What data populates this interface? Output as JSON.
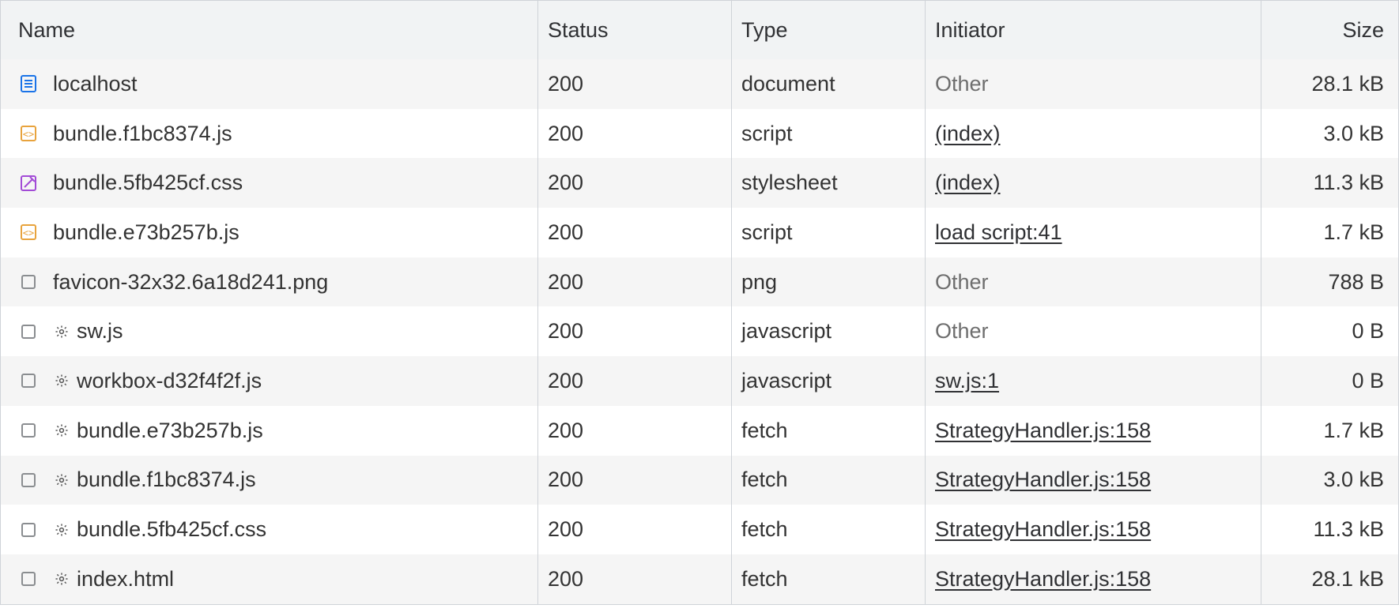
{
  "columns": {
    "name": "Name",
    "status": "Status",
    "type": "Type",
    "initiator": "Initiator",
    "size": "Size"
  },
  "rows": [
    {
      "icon": "document",
      "gear": false,
      "name": "localhost",
      "status": "200",
      "type": "document",
      "initiator": "Other",
      "initiator_link": false,
      "size": "28.1 kB"
    },
    {
      "icon": "js",
      "gear": false,
      "name": "bundle.f1bc8374.js",
      "status": "200",
      "type": "script",
      "initiator": "(index)",
      "initiator_link": true,
      "size": "3.0 kB"
    },
    {
      "icon": "css",
      "gear": false,
      "name": "bundle.5fb425cf.css",
      "status": "200",
      "type": "stylesheet",
      "initiator": "(index)",
      "initiator_link": true,
      "size": "11.3 kB"
    },
    {
      "icon": "js",
      "gear": false,
      "name": "bundle.e73b257b.js",
      "status": "200",
      "type": "script",
      "initiator": "load script:41",
      "initiator_link": true,
      "size": "1.7 kB"
    },
    {
      "icon": "blank",
      "gear": false,
      "name": "favicon-32x32.6a18d241.png",
      "status": "200",
      "type": "png",
      "initiator": "Other",
      "initiator_link": false,
      "size": "788 B"
    },
    {
      "icon": "blank",
      "gear": true,
      "name": "sw.js",
      "status": "200",
      "type": "javascript",
      "initiator": "Other",
      "initiator_link": false,
      "size": "0 B"
    },
    {
      "icon": "blank",
      "gear": true,
      "name": "workbox-d32f4f2f.js",
      "status": "200",
      "type": "javascript",
      "initiator": "sw.js:1",
      "initiator_link": true,
      "size": "0 B"
    },
    {
      "icon": "blank",
      "gear": true,
      "name": "bundle.e73b257b.js",
      "status": "200",
      "type": "fetch",
      "initiator": "StrategyHandler.js:158",
      "initiator_link": true,
      "size": "1.7 kB"
    },
    {
      "icon": "blank",
      "gear": true,
      "name": "bundle.f1bc8374.js",
      "status": "200",
      "type": "fetch",
      "initiator": "StrategyHandler.js:158",
      "initiator_link": true,
      "size": "3.0 kB"
    },
    {
      "icon": "blank",
      "gear": true,
      "name": "bundle.5fb425cf.css",
      "status": "200",
      "type": "fetch",
      "initiator": "StrategyHandler.js:158",
      "initiator_link": true,
      "size": "11.3 kB"
    },
    {
      "icon": "blank",
      "gear": true,
      "name": "index.html",
      "status": "200",
      "type": "fetch",
      "initiator": "StrategyHandler.js:158",
      "initiator_link": true,
      "size": "28.1 kB"
    }
  ]
}
